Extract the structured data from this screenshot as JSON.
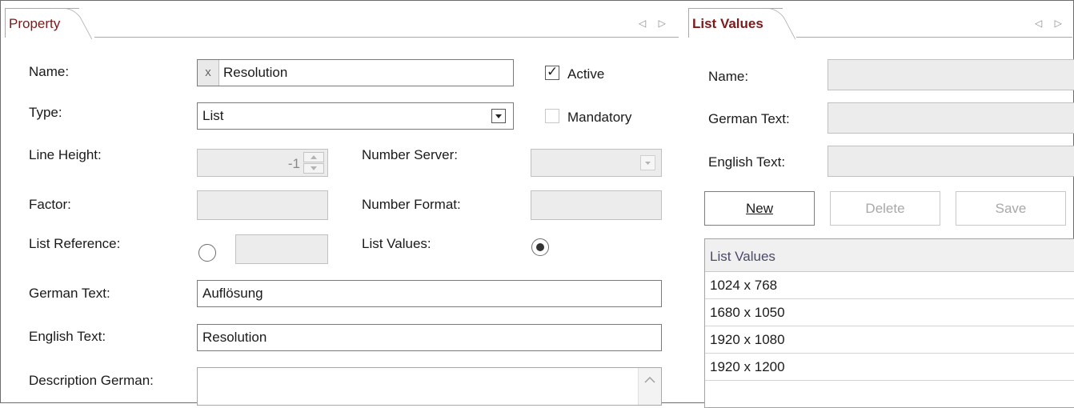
{
  "property_panel": {
    "tab_label": "Property",
    "nav_arrows": "◁ ▷",
    "labels": {
      "name": "Name:",
      "type": "Type:",
      "line_height": "Line Height:",
      "number_server": "Number Server:",
      "factor": "Factor:",
      "number_format": "Number Format:",
      "list_reference": "List Reference:",
      "list_values": "List Values:",
      "german_text": "German Text:",
      "english_text": "English Text:",
      "description_german": "Description German:"
    },
    "fields": {
      "name_prefix": "x",
      "name_value": "Resolution",
      "type_value": "List",
      "line_height_value": "-1",
      "factor_value": "",
      "number_format_value": "",
      "list_reference_value": "",
      "german_text_value": "Auflösung",
      "english_text_value": "Resolution",
      "description_german_value": ""
    },
    "checkboxes": {
      "active_label": "Active",
      "active_checked": true,
      "mandatory_label": "Mandatory",
      "mandatory_checked": false
    },
    "radios": {
      "list_reference_selected": false,
      "list_values_selected": true
    }
  },
  "list_values_panel": {
    "tab_label": "List Values",
    "nav_arrows": "◁ ▷",
    "labels": {
      "name": "Name:",
      "german_text": "German Text:",
      "english_text": "English Text:"
    },
    "buttons": {
      "new": "New",
      "delete": "Delete",
      "save": "Save"
    },
    "grid": {
      "header": "List Values",
      "rows": [
        "1024 x 768",
        "1680 x 1050",
        "1920 x 1080",
        "1920 x 1200"
      ]
    }
  },
  "icons": {
    "dropdown": "triangle-down-icon",
    "checkmark": "checkmark-icon",
    "scroll_up": "chevron-up-icon"
  }
}
